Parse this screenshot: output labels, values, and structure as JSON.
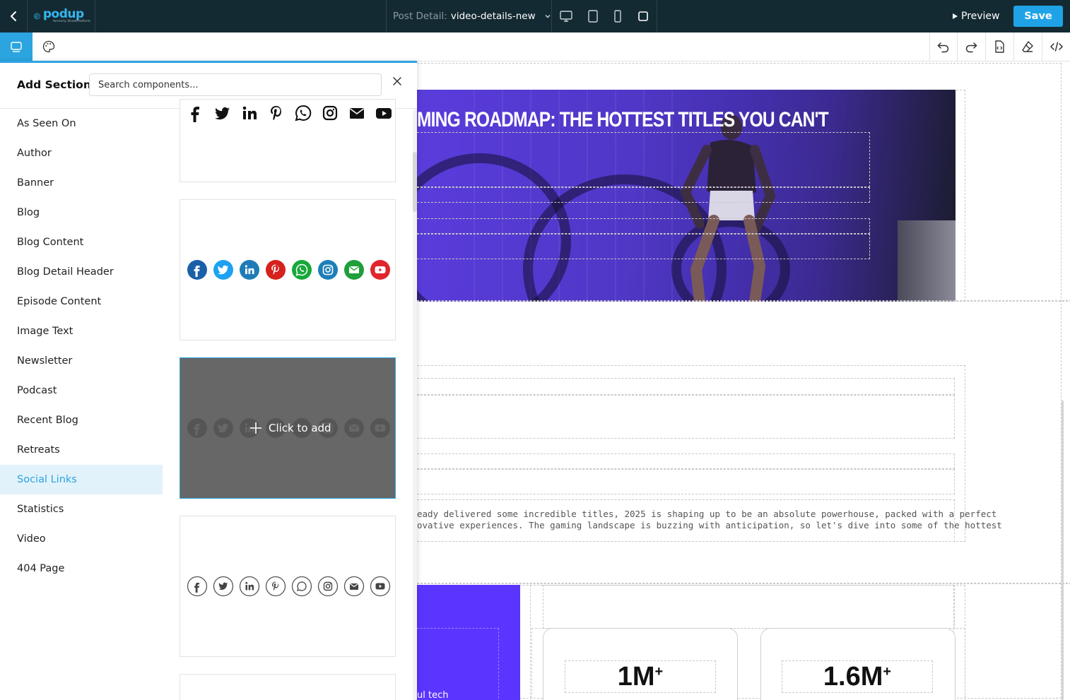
{
  "topbar": {
    "logo_text": "podup",
    "logo_tagline": "formerly StreetPlatform",
    "page_label": "Post Detail:",
    "page_value": "video-details-new",
    "preview_label": "Preview",
    "save_label": "Save"
  },
  "panel": {
    "title": "Add Section",
    "search_placeholder": "Search components...",
    "categories": [
      {
        "label": "As Seen On"
      },
      {
        "label": "Author"
      },
      {
        "label": "Banner"
      },
      {
        "label": "Blog"
      },
      {
        "label": "Blog Content"
      },
      {
        "label": "Blog Detail Header"
      },
      {
        "label": "Episode Content"
      },
      {
        "label": "Image Text"
      },
      {
        "label": "Newsletter"
      },
      {
        "label": "Podcast"
      },
      {
        "label": "Recent Blog"
      },
      {
        "label": "Retreats"
      },
      {
        "label": "Social Links"
      },
      {
        "label": "Statistics"
      },
      {
        "label": "Video"
      },
      {
        "label": "404 Page"
      }
    ],
    "active_category": "Social Links",
    "click_to_add": "Click to add"
  },
  "social_icons": [
    "facebook-icon",
    "twitter-icon",
    "linkedin-icon",
    "pinterest-icon",
    "whatsapp-icon",
    "instagram-icon",
    "email-icon",
    "youtube-icon"
  ],
  "icon_colors": {
    "facebook": "#1b5fa8",
    "twitter": "#1da1f2",
    "linkedin": "#1f7bb6",
    "pinterest": "#d6211d",
    "whatsapp": "#16a83a",
    "instagram": "#1d7fb8",
    "email": "#1f9f3a",
    "youtube": "#e0262b"
  },
  "canvas": {
    "hero_title": "MING ROADMAP: THE HOTTEST TITLES YOU CAN'T",
    "body_line1": "eady delivered some incredible titles, 2025 is shaping up to be an absolute powerhouse, packed with a perfect",
    "body_line2": "ovative experiences. The gaming landscape is buzzing with anticipation, so let's dive into some of the hottest",
    "purple_caption": "ul tech",
    "stats": [
      {
        "value": "1M",
        "suffix": "+"
      },
      {
        "value": "1.6M",
        "suffix": "+"
      }
    ]
  },
  "colors": {
    "topbar_bg": "#142a33",
    "accent": "#2ba4e0",
    "save_button": "#1fa3e6",
    "hero_purple": "#5037c6",
    "stat_block_purple": "#5b34ff"
  }
}
